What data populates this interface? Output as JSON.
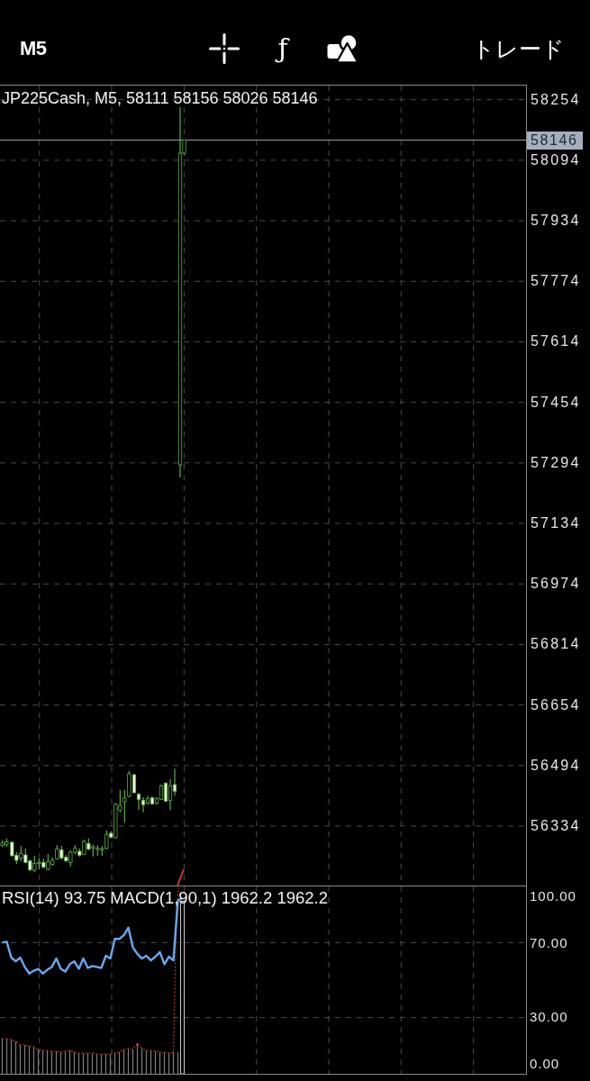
{
  "toolbar": {
    "timeframe": "M5",
    "function_glyph": "ƒ",
    "trade": "トレード"
  },
  "price_chart": {
    "header": "JP225Cash, M5, 58111 58156 58026 58146",
    "price_labels": [
      "58254",
      "58094",
      "57934",
      "57774",
      "57614",
      "57454",
      "57294",
      "57134",
      "56974",
      "56814",
      "56654",
      "56494",
      "56334"
    ],
    "current_price": "58146"
  },
  "indicator_panel": {
    "header": "RSI(14) 93.75 MACD(1,90,1) 1962.2 1962.2",
    "axis_labels": [
      "100.00",
      "70.00",
      "30.00",
      "0.00"
    ]
  }
}
